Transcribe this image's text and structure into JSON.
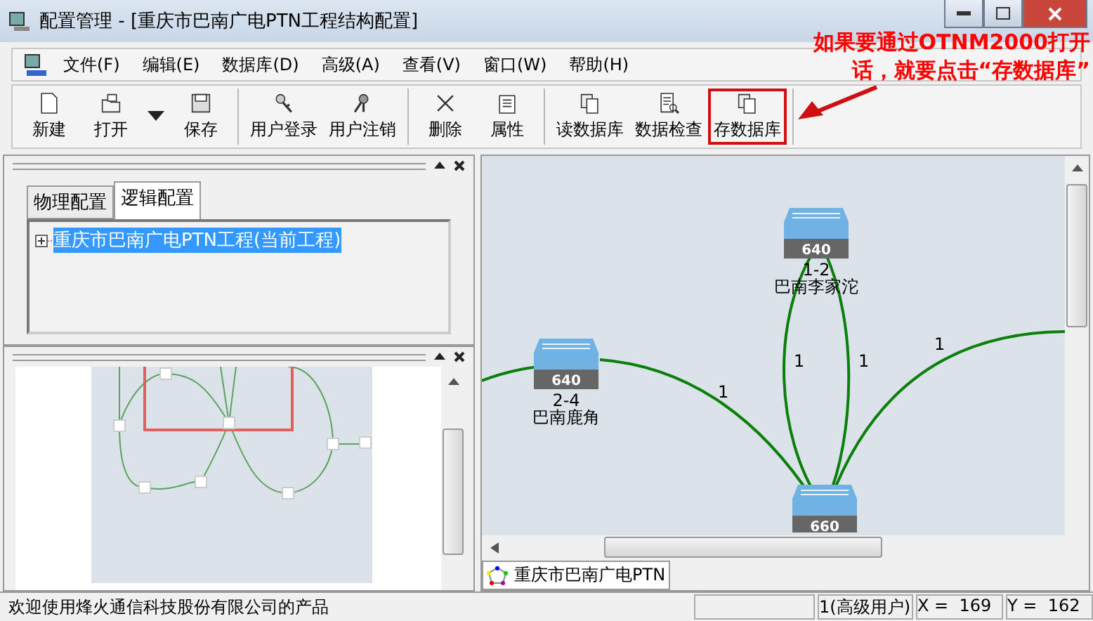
{
  "window": {
    "title": "配置管理 - [重庆市巴南广电PTN工程结构配置]"
  },
  "annotation": {
    "lines": [
      "如果要通过OTNM2000打开",
      "话，就要点击“存数据库”"
    ]
  },
  "menu": [
    "文件(F)",
    "编辑(E)",
    "数据库(D)",
    "高级(A)",
    "查看(V)",
    "窗口(W)",
    "帮助(H)"
  ],
  "toolbar_groups": [
    [
      {
        "label": "新建",
        "has_menu": false,
        "highlighted": false
      },
      {
        "label": "打开",
        "has_menu": true,
        "highlighted": false
      },
      {
        "label": "保存",
        "has_menu": false,
        "highlighted": false
      }
    ],
    [
      {
        "label": "用户登录",
        "has_menu": false,
        "highlighted": false
      },
      {
        "label": "用户注销",
        "has_menu": false,
        "highlighted": false
      }
    ],
    [
      {
        "label": "删除",
        "has_menu": false,
        "highlighted": false
      },
      {
        "label": "属性",
        "has_menu": false,
        "highlighted": false
      }
    ],
    [
      {
        "label": "读数据库",
        "has_menu": false,
        "highlighted": false
      },
      {
        "label": "数据检查",
        "has_menu": false,
        "highlighted": false
      },
      {
        "label": "存数据库",
        "has_menu": false,
        "highlighted": true
      }
    ]
  ],
  "config_panel": {
    "tabs": [
      {
        "label": "物理配置",
        "selected": false
      },
      {
        "label": "逻辑配置",
        "selected": true
      }
    ],
    "tree": [
      {
        "label": "重庆市巴南广电PTN工程(当前工程)",
        "selected": true,
        "expanded": false
      }
    ]
  },
  "topology": {
    "nodes": [
      {
        "model": "640",
        "number": "1-2",
        "name": "巴南李家沱"
      },
      {
        "model": "640",
        "number": "2-4",
        "name": "巴南鹿角"
      },
      {
        "model": "660"
      }
    ],
    "link_labels": [
      "1",
      "1",
      "1",
      "1"
    ]
  },
  "document_tabs": [
    {
      "label": "重庆市巴南广电PTN",
      "selected": true
    }
  ],
  "status_bar": {
    "message": "欢迎使用烽火通信科技股份有限公司的产品",
    "user": "1(高级用户)",
    "x": "X =  169",
    "y": "Y =  162"
  }
}
